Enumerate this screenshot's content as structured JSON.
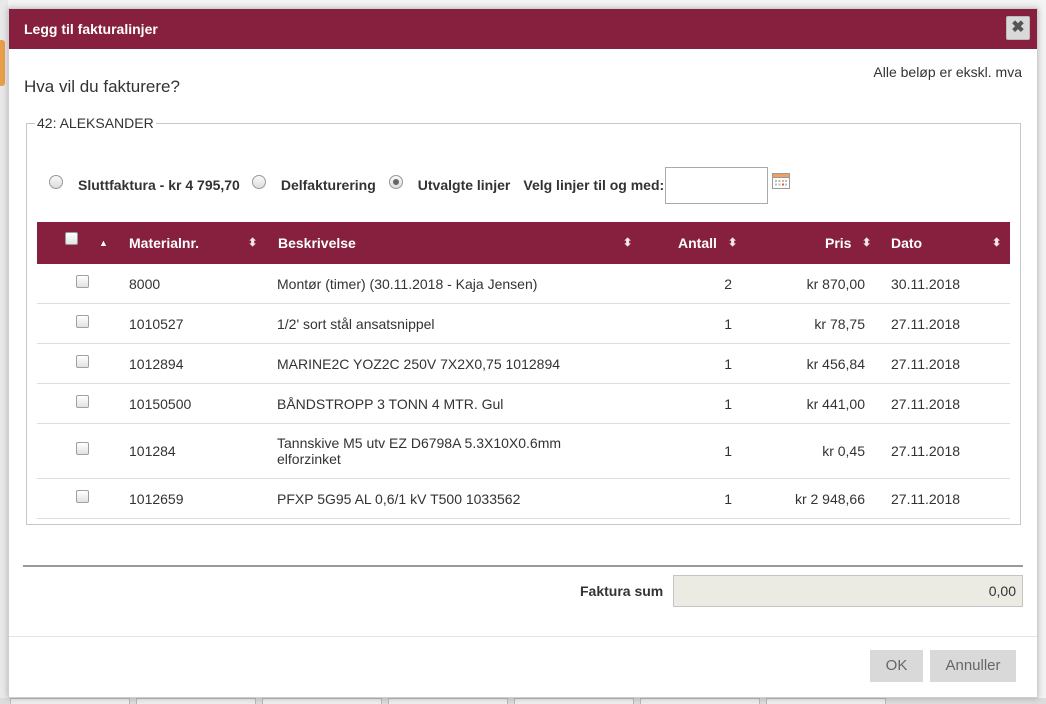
{
  "dialog": {
    "title": "Legg til fakturalinjer",
    "close_glyph": "✖",
    "question": "Hva vil du fakturere?",
    "excl_vat_note": "Alle beløp er ekskl. mva"
  },
  "customer": {
    "legend": "42: ALEKSANDER"
  },
  "options": {
    "final_invoice": "Sluttfaktura - kr 4 795,70",
    "partial_invoice": "Delfakturering",
    "selected_lines": "Utvalgte linjer",
    "select_until_label": "Velg linjer til og med:",
    "select_until_value": "",
    "selected_option": "selected_lines"
  },
  "grid": {
    "columns": {
      "material": "Materialnr.",
      "description": "Beskrivelse",
      "quantity": "Antall",
      "price": "Pris",
      "date": "Dato"
    },
    "rows": [
      {
        "material": "8000",
        "description": "Montør (timer) (30.11.2018 - Kaja Jensen)",
        "quantity": "2",
        "price": "kr 870,00",
        "date": "30.11.2018",
        "checked": false
      },
      {
        "material": "1010527",
        "description": "1/2' sort stål ansatsnippel",
        "quantity": "1",
        "price": "kr 78,75",
        "date": "27.11.2018",
        "checked": false
      },
      {
        "material": "1012894",
        "description": "MARINE2C YOZ2C 250V 7X2X0,75 1012894",
        "quantity": "1",
        "price": "kr 456,84",
        "date": "27.11.2018",
        "checked": false
      },
      {
        "material": "10150500",
        "description": "BÅNDSTROPP 3 TONN 4 MTR. Gul",
        "quantity": "1",
        "price": "kr 441,00",
        "date": "27.11.2018",
        "checked": false
      },
      {
        "material": "101284",
        "description": "Tannskive M5 utv EZ D6798A 5.3X10X0.6mm elforzinket",
        "quantity": "1",
        "price": "kr 0,45",
        "date": "27.11.2018",
        "checked": false
      },
      {
        "material": "1012659",
        "description": "PFXP 5G95 AL 0,6/1 kV T500 1033562",
        "quantity": "1",
        "price": "kr 2 948,66",
        "date": "27.11.2018",
        "checked": false
      }
    ]
  },
  "summary": {
    "label": "Faktura sum",
    "value": "0,00"
  },
  "buttons": {
    "ok": "OK",
    "cancel": "Annuller"
  },
  "colors": {
    "accent": "#87203f",
    "button_bg": "#d9d9d9",
    "sum_bg": "#ebebe4"
  },
  "icons": {
    "close": "close-icon",
    "calendar": "calendar-icon",
    "sort": "sort-icon",
    "sort_asc": "sort-asc-icon"
  }
}
